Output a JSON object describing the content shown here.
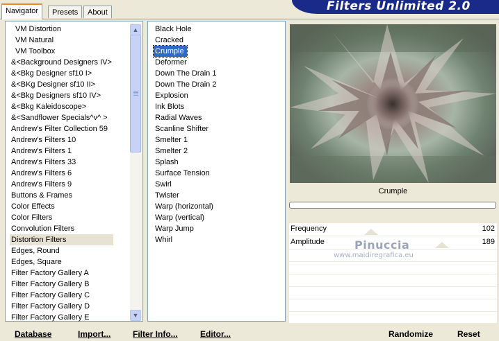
{
  "tabs": [
    {
      "label": "Navigator",
      "active": true
    },
    {
      "label": "Presets",
      "active": false
    },
    {
      "label": "About",
      "active": false
    }
  ],
  "title": "Filters Unlimited 2.0",
  "categories": [
    {
      "label": "VM Distortion",
      "indent": true
    },
    {
      "label": "VM Natural",
      "indent": true
    },
    {
      "label": "VM Toolbox",
      "indent": true
    },
    {
      "label": "&<Background Designers IV>"
    },
    {
      "label": "&<Bkg Designer sf10 I>"
    },
    {
      "label": "&<BKg Designer sf10 II>"
    },
    {
      "label": "&<Bkg Designers sf10 IV>"
    },
    {
      "label": "&<Bkg Kaleidoscope>"
    },
    {
      "label": "&<Sandflower Specials^v^ >"
    },
    {
      "label": "Andrew's Filter Collection 59"
    },
    {
      "label": "Andrew's Filters 10"
    },
    {
      "label": "Andrew's Filters 1"
    },
    {
      "label": "Andrew's Filters 33"
    },
    {
      "label": "Andrew's Filters 6"
    },
    {
      "label": "Andrew's Filters 9"
    },
    {
      "label": "Buttons & Frames"
    },
    {
      "label": "Color Effects"
    },
    {
      "label": "Color Filters"
    },
    {
      "label": "Convolution Filters"
    },
    {
      "label": "Distortion Filters",
      "selected": true
    },
    {
      "label": "Edges, Round"
    },
    {
      "label": "Edges, Square"
    },
    {
      "label": "Filter Factory Gallery A"
    },
    {
      "label": "Filter Factory Gallery B"
    },
    {
      "label": "Filter Factory Gallery C"
    },
    {
      "label": "Filter Factory Gallery D"
    },
    {
      "label": "Filter Factory Gallery E"
    }
  ],
  "filters": [
    {
      "label": "Black Hole"
    },
    {
      "label": "Cracked"
    },
    {
      "label": "Crumple",
      "selected": true
    },
    {
      "label": "Deformer"
    },
    {
      "label": "Down The Drain 1"
    },
    {
      "label": "Down The Drain 2"
    },
    {
      "label": "Explosion"
    },
    {
      "label": "Ink Blots"
    },
    {
      "label": "Radial Waves"
    },
    {
      "label": "Scanline Shifter"
    },
    {
      "label": "Smelter 1"
    },
    {
      "label": "Smelter 2"
    },
    {
      "label": "Splash"
    },
    {
      "label": "Surface Tension"
    },
    {
      "label": "Swirl"
    },
    {
      "label": "Twister"
    },
    {
      "label": "Warp (horizontal)"
    },
    {
      "label": "Warp (vertical)"
    },
    {
      "label": "Warp Jump"
    },
    {
      "label": "Whirl"
    }
  ],
  "preview": {
    "filter_name": "Crumple"
  },
  "sliders": [
    {
      "label": "Frequency",
      "value": "102"
    },
    {
      "label": "Amplitude",
      "value": "189"
    }
  ],
  "watermark": {
    "name": "Pinuccia",
    "url": "www.maidiregrafica.eu"
  },
  "buttons": {
    "database": "Database",
    "import": "Import...",
    "filter_info": "Filter Info...",
    "editor": "Editor...",
    "randomize": "Randomize",
    "reset": "Reset"
  },
  "colors": {
    "banner": "#1a2a88",
    "selection": "#316ac5",
    "tab_accent": "#e68b2c"
  },
  "icons": {
    "scroll_up": "scroll-up-arrow-icon",
    "scroll_down": "scroll-down-arrow-icon"
  }
}
